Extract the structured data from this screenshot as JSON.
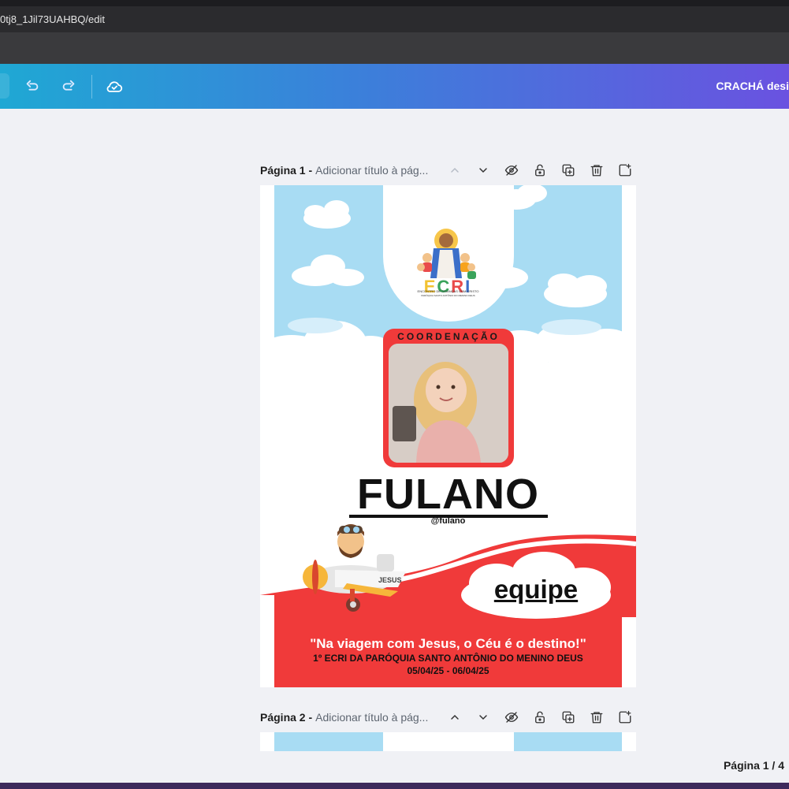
{
  "browser": {
    "url": "0tj8_1Jil73UAHBQ/edit"
  },
  "appbar": {
    "document_title": "CRACHÁ desi",
    "icons": [
      "undo-icon",
      "redo-icon",
      "cloud-saved-icon"
    ]
  },
  "pages": [
    {
      "label": "Página 1 -",
      "title_placeholder": "Adicionar título à pág..."
    },
    {
      "label": "Página 2 -",
      "title_placeholder": "Adicionar título à pág..."
    }
  ],
  "page_tool_icons": [
    "chevron-up-icon",
    "chevron-down-icon",
    "hide-icon",
    "lock-icon",
    "duplicate-icon",
    "trash-icon",
    "add-page-icon"
  ],
  "badge": {
    "logo_text": "ECRI",
    "logo_subtitle": "ENCONTRO DE CRIANÇAS COM CRISTO",
    "logo_subtitle2": "PARÓQUIA SANTO ANTÔNIO DO MENINO DEUS",
    "role": "COORDENAÇÃO",
    "name": "FULANO",
    "handle": "@fulano",
    "plane_label": "JESUS",
    "team": "equipe",
    "slogan": "\"Na viagem com Jesus, o Céu é o destino!\"",
    "event": "1º ECRI DA PARÓQUIA SANTO ANTÔNIO DO MENINO DEUS",
    "dates": "05/04/25 - 06/04/25"
  },
  "footer": {
    "page_indicator": "Página 1 / 4"
  },
  "colors": {
    "sky": "#a8dcf3",
    "badge_red": "#f03a3a",
    "brand_gradient_start": "#1fa8d4",
    "brand_gradient_end": "#6a52e0"
  }
}
